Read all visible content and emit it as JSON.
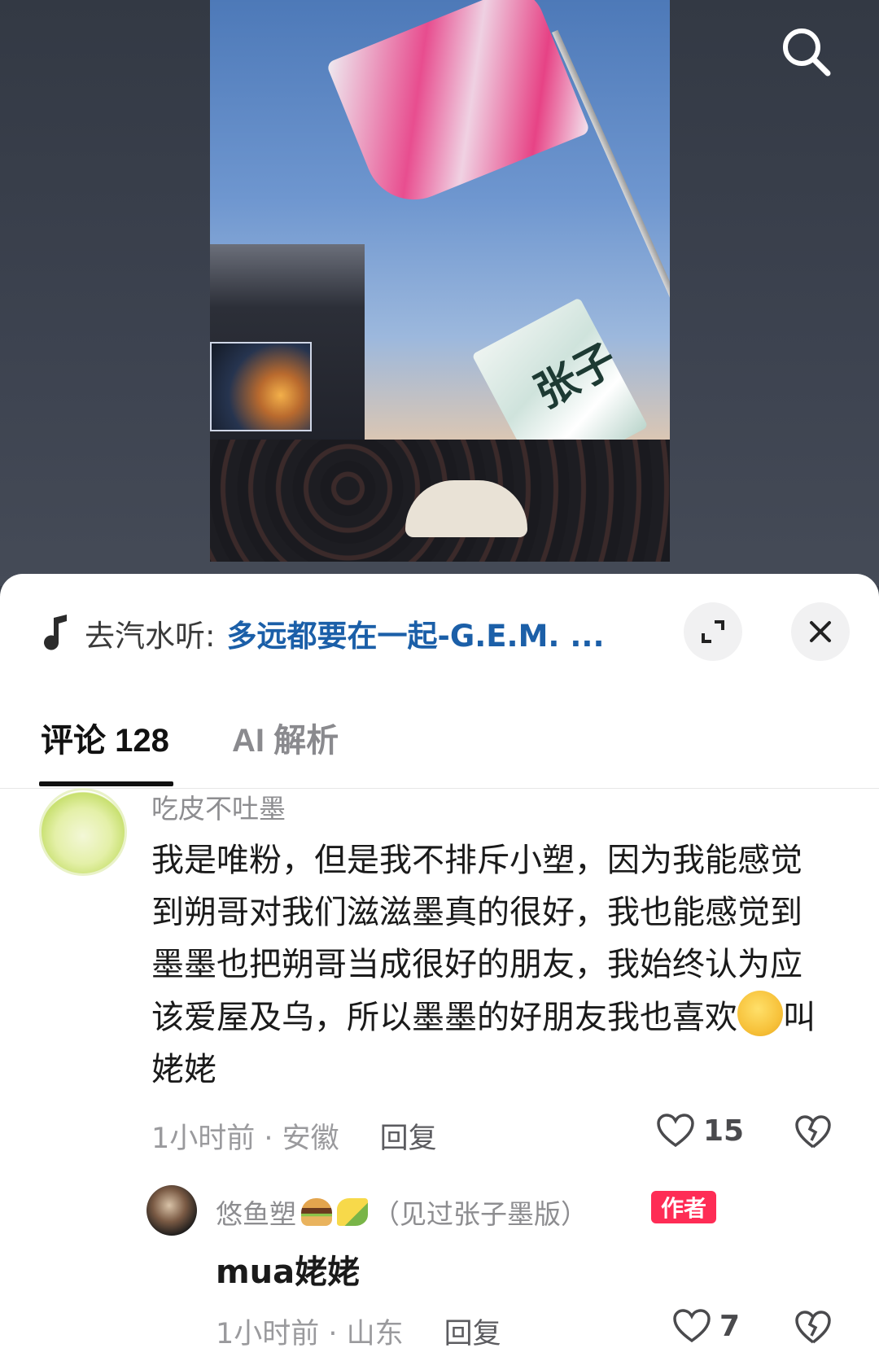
{
  "header": {
    "search_icon": "search-icon"
  },
  "video": {
    "flag_text": "张子"
  },
  "music": {
    "prefix": "去汽水听:",
    "title": "多远都要在一起-G.E.M. ...",
    "icon": "music-note-icon"
  },
  "sheet": {
    "expand_icon": "expand-icon",
    "close_icon": "close-icon"
  },
  "tabs": [
    {
      "label": "评论 128",
      "active": true
    },
    {
      "label": "AI 解析",
      "active": false
    }
  ],
  "comments": [
    {
      "author": "吃皮不吐墨",
      "text_before_emoji": "我是唯粉，但是我不排斥小塑，因为我能感觉到朔哥对我们滋滋墨真的很好，我也能感觉到墨墨也把朔哥当成很好的朋友，我始终认为应该爱屋及乌，所以墨墨的好朋友我也喜欢",
      "text_after_emoji": "叫姥姥",
      "emoji": "thinking-face-emoji",
      "time_location": "1小时前 · 安徽",
      "reply_label": "回复",
      "likes": "15"
    }
  ],
  "replies": [
    {
      "author_prefix": "悠鱼塑",
      "author_suffix": "（见过张子墨版）",
      "badge": "作者",
      "text": "mua姥姥",
      "time_location": "1小时前 · 山东",
      "reply_label": "回复",
      "likes": "7"
    }
  ],
  "colors": {
    "accent_link": "#1b5fa8",
    "author_badge": "#fe2c55",
    "tab_active": "#111111",
    "tab_inactive": "#8a8a8e"
  }
}
